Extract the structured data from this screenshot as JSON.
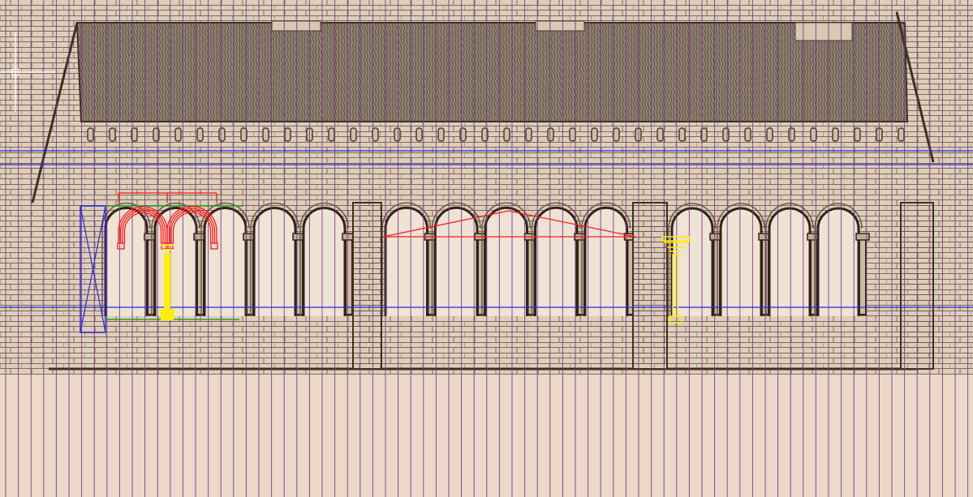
{
  "app": {
    "title": ""
  },
  "colors": {
    "background": "#eddccb",
    "sketch_ink": "#4a3c2e",
    "roof_fill": "#8a7c6e",
    "grid_line": "#7a2e9a",
    "guide_line": "#2a2ad6",
    "arch_overlay": "#ff1a1a",
    "column_overlay": "#ffee00",
    "baseline_overlay": "#2aa02a",
    "crosshair": "#ffffff"
  },
  "icons": {
    "cursor": "crosshair-cursor-icon"
  },
  "drawing": {
    "arcade_bays": 15,
    "grid": "on",
    "overlays": [
      "arch-outline",
      "column-outline",
      "gable-line",
      "selection-box",
      "column-detail"
    ]
  }
}
